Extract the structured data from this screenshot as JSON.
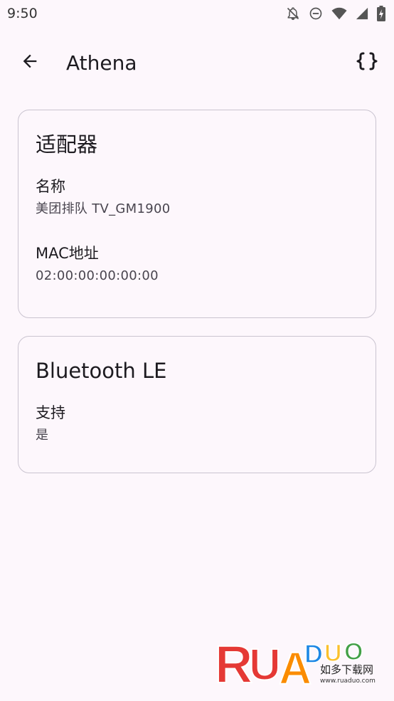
{
  "status_bar": {
    "time": "9:50",
    "icons": [
      "notifications-off-icon",
      "do-not-disturb-icon",
      "wifi-icon",
      "battery-charging-icon"
    ]
  },
  "app_bar": {
    "title": "Athena",
    "back_icon": "arrow-back-icon",
    "action_icon": "braces-icon"
  },
  "cards": {
    "adapter": {
      "title": "适配器",
      "fields": [
        {
          "label": "名称",
          "value": "美团排队 TV_GM1900"
        },
        {
          "label": "MAC地址",
          "value": "02:00:00:00:00:00"
        }
      ]
    },
    "ble": {
      "title": "Bluetooth LE",
      "fields": [
        {
          "label": "支持",
          "value": "是"
        }
      ]
    }
  },
  "watermark": {
    "text": "如多下载网",
    "url": "www.ruaduo.com"
  },
  "colors": {
    "background": "#fdf7fc",
    "card_border": "#cac4d0",
    "text_primary": "#1d1b20",
    "text_secondary": "#49454f"
  }
}
